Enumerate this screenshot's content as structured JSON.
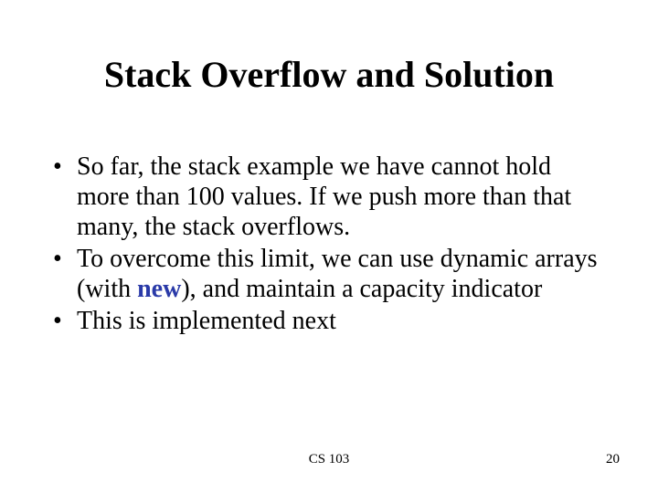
{
  "title": "Stack Overflow and Solution",
  "bullets": {
    "b1_a": "So far, the stack example we have cannot hold more than 100 values. If we push more than that many, the stack overflows.",
    "b2_a": "To overcome this limit, we can use dynamic arrays (with ",
    "b2_kw": "new",
    "b2_b": "), and maintain a capacity indicator",
    "b3_a": "This is implemented next"
  },
  "footer": {
    "course": "CS 103",
    "page": "20"
  },
  "colors": {
    "keyword": "#2a3aa8"
  }
}
